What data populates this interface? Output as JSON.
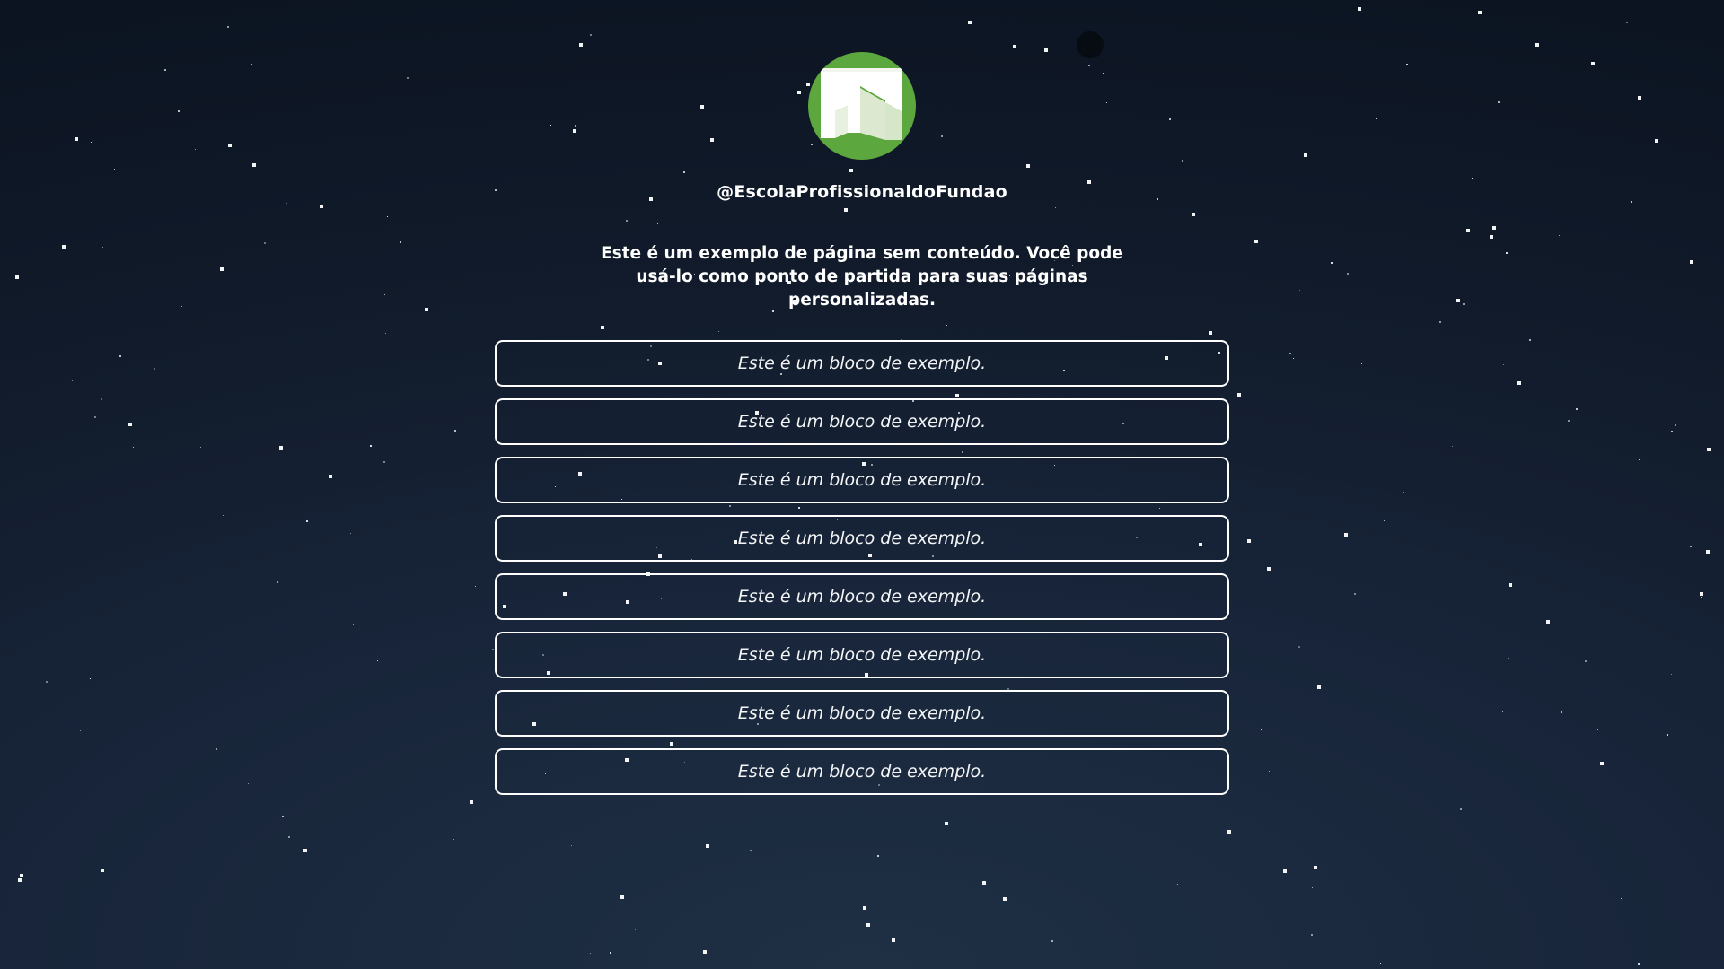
{
  "profile": {
    "avatar_icon": "school-building-logo-icon",
    "handle": "@EscolaProfissionaldoFundao",
    "description": "Este é um exemplo de página sem conteúdo. Você pode usá-lo como ponto de partida para suas páginas personalizadas."
  },
  "links": [
    {
      "label": "Este é um bloco de exemplo."
    },
    {
      "label": "Este é um bloco de exemplo."
    },
    {
      "label": "Este é um bloco de exemplo."
    },
    {
      "label": "Este é um bloco de exemplo."
    },
    {
      "label": "Este é um bloco de exemplo."
    },
    {
      "label": "Este é um bloco de exemplo."
    },
    {
      "label": "Este é um bloco de exemplo."
    },
    {
      "label": "Este é um bloco de exemplo."
    }
  ],
  "colors": {
    "background_top": "#0b1320",
    "background_bottom": "#1f3044",
    "avatar_green": "#5ca73e",
    "text": "#ffffff"
  }
}
